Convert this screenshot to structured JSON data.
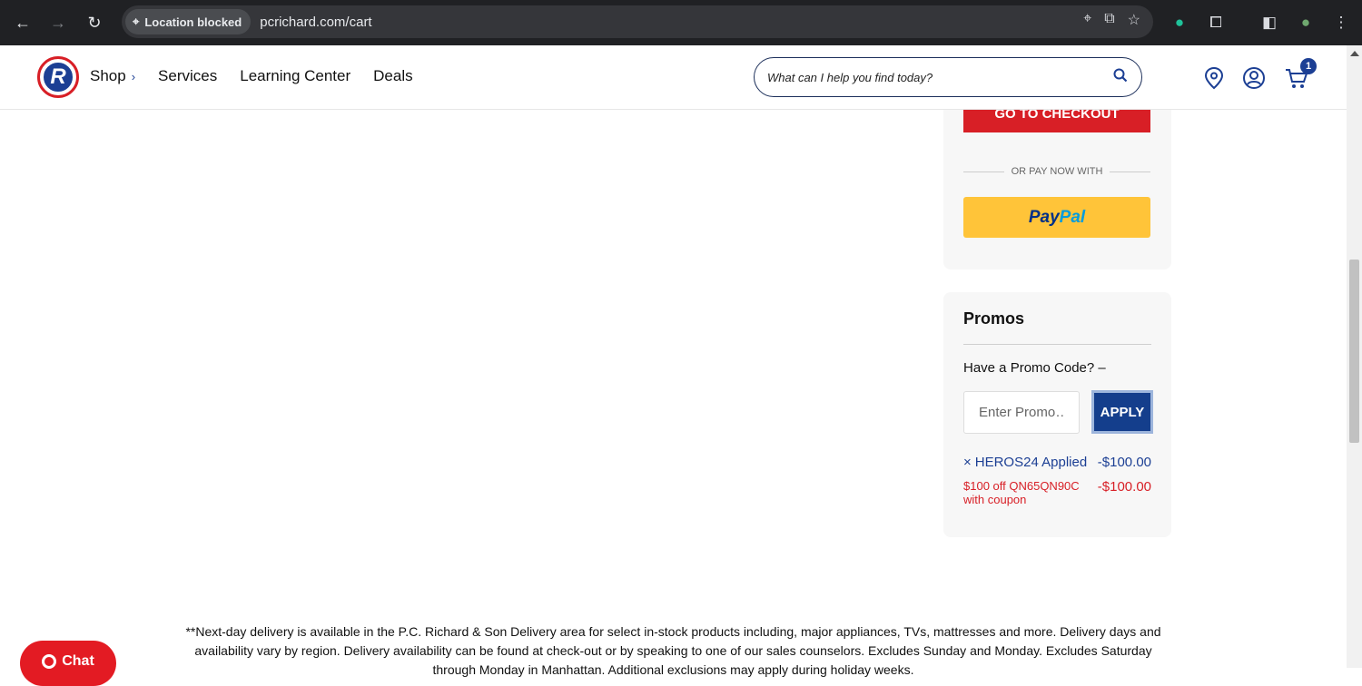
{
  "browser": {
    "location_chip": "Location blocked",
    "url": "pcrichard.com/cart"
  },
  "header": {
    "logo_text": "R",
    "menu": [
      {
        "label": "Shop"
      },
      {
        "label": "Services"
      },
      {
        "label": "Learning Center"
      },
      {
        "label": "Deals"
      }
    ],
    "search_placeholder": "What can I help you find today?",
    "cart_count": "1"
  },
  "summary": {
    "checkout_label": "GO TO CHECKOUT",
    "or_pay_label": "OR PAY NOW WITH",
    "paypal_part1": "Pay",
    "paypal_part2": "Pal"
  },
  "promos": {
    "title": "Promos",
    "question": "Have a Promo Code? –",
    "input_placeholder": "Enter Promo…",
    "apply_label": "APPLY",
    "applied": {
      "remove": "×",
      "label": "HEROS24 Applied",
      "amount": "-$100.00"
    },
    "discount": {
      "label": "$100 off QN65QN90C with coupon",
      "amount": "-$100.00"
    }
  },
  "footnote": "**Next-day delivery is available in the P.C. Richard & Son Delivery area for select in-stock products including, major appliances, TVs, mattresses and more. Delivery days and availability vary by region. Delivery availability can be found at check-out or by speaking to one of our sales counselors. Excludes Sunday and Monday. Excludes Saturday through Monday in Manhattan. Additional exclusions may apply during holiday weeks.",
  "chat": {
    "label": "Chat"
  },
  "colors": {
    "brand_red": "#d81f26",
    "brand_blue": "#1c3f94",
    "paypal_yellow": "#ffc439"
  }
}
